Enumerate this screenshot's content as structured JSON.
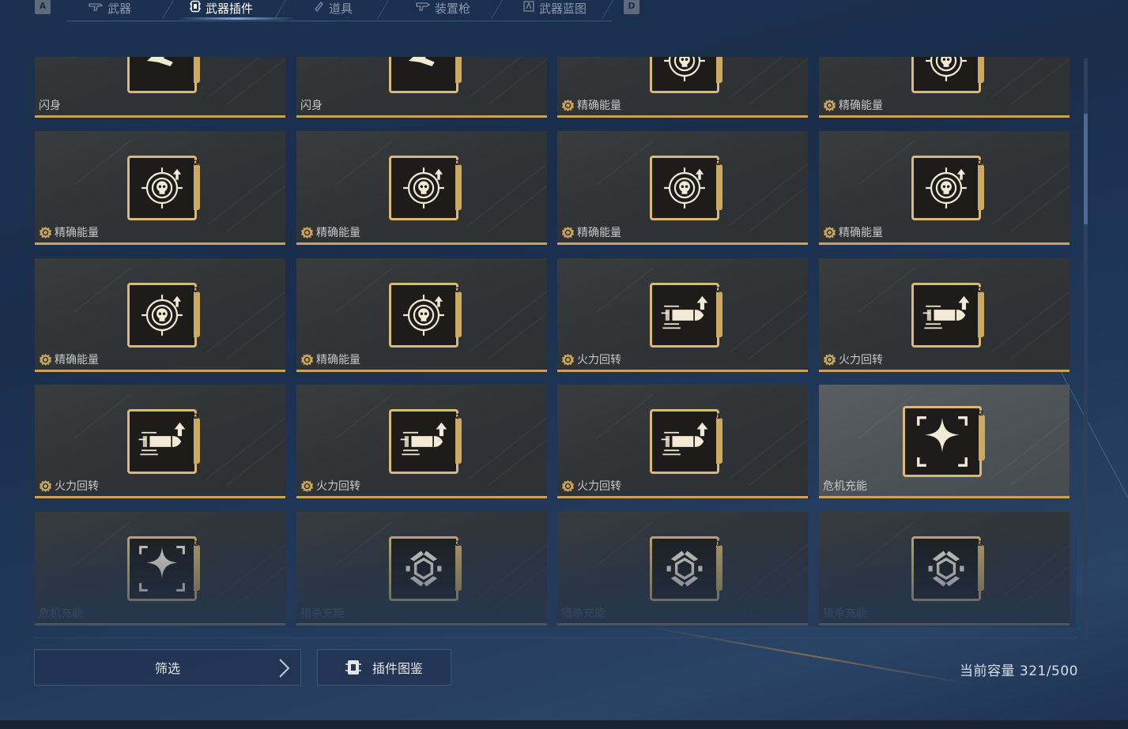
{
  "tabs": {
    "left_key": "A",
    "right_key": "D",
    "items": [
      {
        "label": "武器",
        "icon": "gun-icon",
        "active": false
      },
      {
        "label": "武器插件",
        "icon": "plugin-chip-icon",
        "active": true
      },
      {
        "label": "道具",
        "icon": "item-icon",
        "active": false
      },
      {
        "label": "装置枪",
        "icon": "device-gun-icon",
        "active": false
      },
      {
        "label": "武器蓝图",
        "icon": "blueprint-icon",
        "active": false
      }
    ]
  },
  "plugins": [
    {
      "name": "闪身",
      "icon": "dash-icon",
      "level": "2",
      "rare": false
    },
    {
      "name": "闪身",
      "icon": "dash-icon",
      "level": "2",
      "rare": false
    },
    {
      "name": "精确能量",
      "icon": "skull-target-icon",
      "level": "2",
      "rare": true
    },
    {
      "name": "精确能量",
      "icon": "skull-target-icon",
      "level": "2",
      "rare": true
    },
    {
      "name": "精确能量",
      "icon": "skull-target-icon",
      "level": "2",
      "rare": true
    },
    {
      "name": "精确能量",
      "icon": "skull-target-icon",
      "level": "2",
      "rare": true
    },
    {
      "name": "精确能量",
      "icon": "skull-target-icon",
      "level": "2",
      "rare": true
    },
    {
      "name": "精确能量",
      "icon": "skull-target-icon",
      "level": "2",
      "rare": true
    },
    {
      "name": "精确能量",
      "icon": "skull-target-icon",
      "level": "2",
      "rare": true
    },
    {
      "name": "精确能量",
      "icon": "skull-target-icon",
      "level": "2",
      "rare": true
    },
    {
      "name": "火力回转",
      "icon": "bullet-arrow-icon",
      "level": "2",
      "rare": true
    },
    {
      "name": "火力回转",
      "icon": "bullet-arrow-icon",
      "level": "2",
      "rare": true
    },
    {
      "name": "火力回转",
      "icon": "bullet-arrow-icon",
      "level": "2",
      "rare": true
    },
    {
      "name": "火力回转",
      "icon": "bullet-arrow-icon",
      "level": "2",
      "rare": true
    },
    {
      "name": "火力回转",
      "icon": "bullet-arrow-icon",
      "level": "1",
      "rare": true
    },
    {
      "name": "危机充能",
      "icon": "four-point-star-icon",
      "level": "2",
      "rare": false,
      "selected": true
    },
    {
      "name": "危机充能",
      "icon": "four-point-star-icon",
      "level": "2",
      "rare": false
    },
    {
      "name": "猎杀充能",
      "icon": "hexagon-reticle-icon",
      "level": "2",
      "rare": false
    },
    {
      "name": "猎杀充能",
      "icon": "hexagon-reticle-icon",
      "level": "1",
      "rare": false
    },
    {
      "name": "猎杀充能",
      "icon": "hexagon-reticle-icon",
      "level": "2",
      "rare": false
    }
  ],
  "footer": {
    "filter_label": "筛选",
    "atlas_label": "插件图鉴",
    "capacity_label": "当前容量",
    "capacity_value": "321/500"
  },
  "colors": {
    "accent_gold": "#c9a35b",
    "background": "#1c3150",
    "card": "#323538"
  }
}
